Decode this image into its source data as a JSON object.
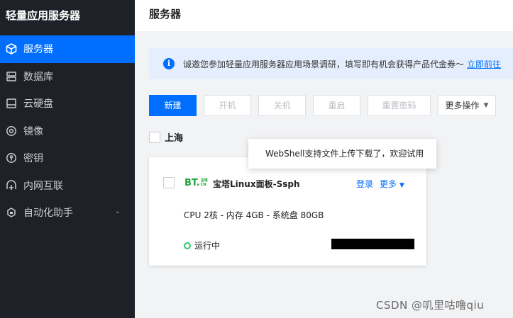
{
  "sidebar": {
    "title": "轻量应用服务器",
    "items": [
      {
        "label": "服务器",
        "icon": "cube-icon",
        "active": true
      },
      {
        "label": "数据库",
        "icon": "database-icon"
      },
      {
        "label": "云硬盘",
        "icon": "disk-icon"
      },
      {
        "label": "镜像",
        "icon": "image-icon"
      },
      {
        "label": "密钥",
        "icon": "key-icon"
      },
      {
        "label": "内网互联",
        "icon": "network-icon"
      },
      {
        "label": "自动化助手",
        "icon": "robot-icon",
        "expandable": true
      }
    ]
  },
  "header": {
    "title": "服务器"
  },
  "notice": {
    "icon": "info-icon",
    "icon_text": "i",
    "text": "诚邀您参加轻量应用服务器应用场景调研，填写即有机会获得产品代金券～",
    "link": "立即前往"
  },
  "toolbar": {
    "create": "新建",
    "start": "开机",
    "stop": "关机",
    "restart": "重启",
    "reset_password": "重置密码",
    "more_actions": "更多操作"
  },
  "region": {
    "label": "上海"
  },
  "instance": {
    "logo": "BT.",
    "logo_small_top": "宝塔",
    "logo_small_bottom": "CN",
    "name": "宝塔Linux面板-Ssph",
    "login": "登录",
    "more": "更多",
    "spec": "CPU 2核 - 内存 4GB - 系统盘 80GB",
    "status": "运行中"
  },
  "tooltip": {
    "text": "WebShell支持文件上传下载了，欢迎试用"
  },
  "watermark": "CSDN @叽里咕噜qiu",
  "colors": {
    "accent": "#006eff",
    "sidebar_bg": "#1f2128",
    "running": "#29cc6a",
    "bt_green": "#20a53a"
  }
}
